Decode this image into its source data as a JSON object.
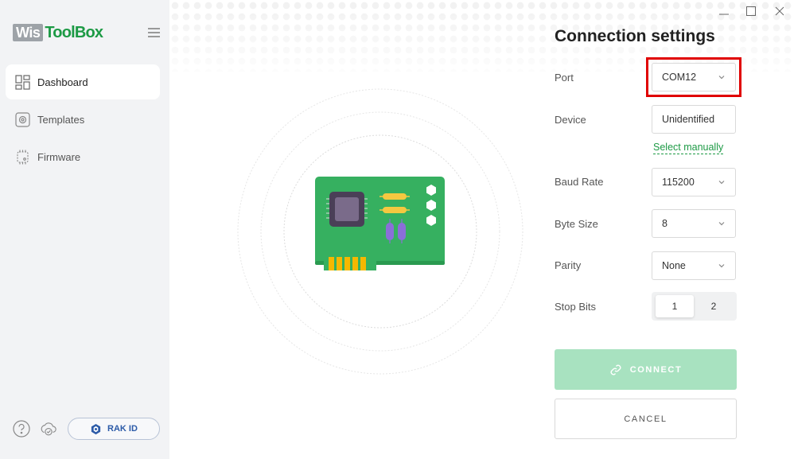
{
  "app": {
    "logo_box": "Wis",
    "logo_text": "ToolBox"
  },
  "sidebar": {
    "items": [
      {
        "label": "Dashboard",
        "icon": "dashboard-icon",
        "active": true
      },
      {
        "label": "Templates",
        "icon": "templates-icon",
        "active": false
      },
      {
        "label": "Firmware",
        "icon": "firmware-chip-icon",
        "active": false
      }
    ],
    "help_icon": "help-question-icon",
    "cloud_icon": "cloud-sync-icon",
    "rak_id_label": "RAK ID"
  },
  "panel": {
    "title": "Connection settings",
    "fields": {
      "port": {
        "label": "Port",
        "value": "COM12"
      },
      "device": {
        "label": "Device",
        "value": "Unidentified",
        "link": "Select manually"
      },
      "baud_rate": {
        "label": "Baud Rate",
        "value": "115200"
      },
      "byte_size": {
        "label": "Byte Size",
        "value": "8"
      },
      "parity": {
        "label": "Parity",
        "value": "None"
      },
      "stop_bits": {
        "label": "Stop Bits",
        "options": [
          "1",
          "2"
        ],
        "selected": "1"
      }
    },
    "connect_label": "CONNECT",
    "cancel_label": "CANCEL"
  },
  "colors": {
    "brand_green": "#1d9a45",
    "connect_disabled": "#a8e2c0",
    "highlight_red": "#e00000",
    "board_green": "#36b060"
  }
}
